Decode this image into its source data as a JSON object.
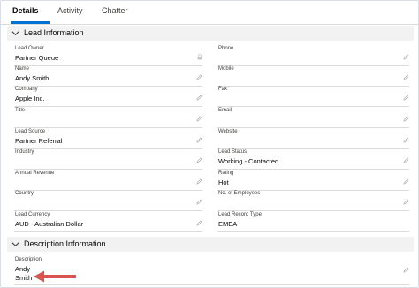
{
  "tabs": {
    "details": "Details",
    "activity": "Activity",
    "chatter": "Chatter"
  },
  "sections": {
    "lead_information": "Lead Information",
    "description_information": "Description Information"
  },
  "fields": {
    "lead_owner": {
      "label": "Lead Owner",
      "value": "Partner Queue"
    },
    "phone": {
      "label": "Phone",
      "value": ""
    },
    "name": {
      "label": "Name",
      "value": "Andy Smith"
    },
    "mobile": {
      "label": "Mobile",
      "value": ""
    },
    "company": {
      "label": "Company",
      "value": "Apple Inc."
    },
    "fax": {
      "label": "Fax",
      "value": ""
    },
    "title": {
      "label": "Title",
      "value": ""
    },
    "email": {
      "label": "Email",
      "value": ""
    },
    "lead_source": {
      "label": "Lead Source",
      "value": "Partner Referral"
    },
    "website": {
      "label": "Website",
      "value": ""
    },
    "industry": {
      "label": "Industry",
      "value": ""
    },
    "lead_status": {
      "label": "Lead Status",
      "value": "Working - Contacted"
    },
    "annual_revenue": {
      "label": "Annual Revenue",
      "value": ""
    },
    "rating": {
      "label": "Rating",
      "value": "Hot"
    },
    "country": {
      "label": "Country",
      "value": ""
    },
    "no_of_employees": {
      "label": "No. of Employees",
      "value": ""
    },
    "lead_currency": {
      "label": "Lead Currency",
      "value": "AUD - Australian Dollar"
    },
    "lead_record_type": {
      "label": "Lead Record Type",
      "value": "EMEA"
    },
    "description": {
      "label": "Description",
      "value_line1": "Andy",
      "value_line2": "Smith"
    }
  },
  "colors": {
    "tab_accent": "#0070d2",
    "section_bg": "#f3f2f2",
    "arrow": "#d9534f"
  },
  "icons": [
    "chevron-down-icon",
    "pencil-icon",
    "lock-icon",
    "arrow-icon"
  ]
}
